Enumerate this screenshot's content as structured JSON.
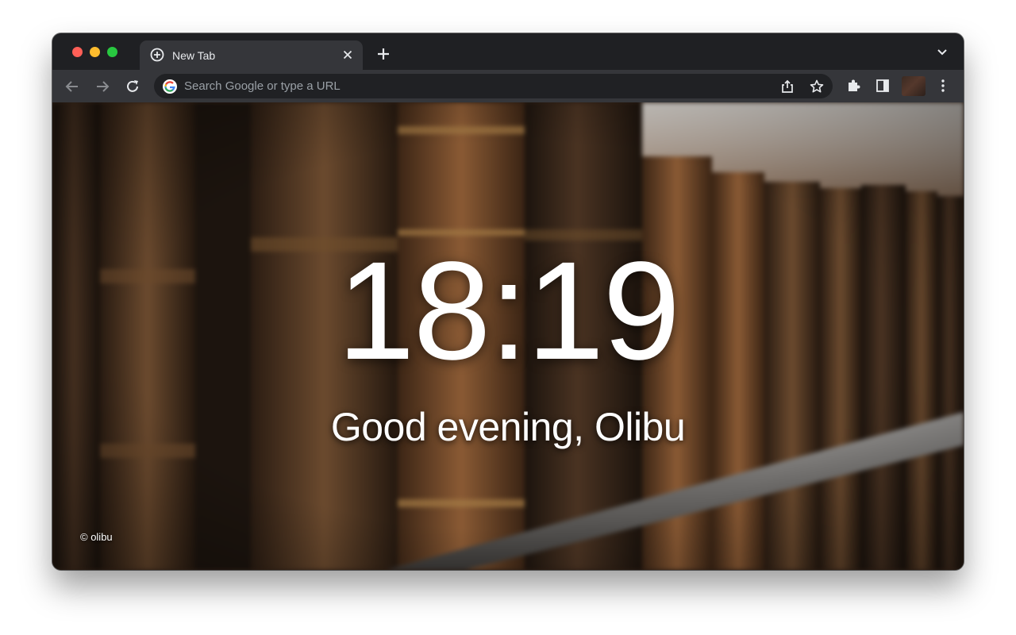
{
  "browser": {
    "tab": {
      "title": "New Tab",
      "close_icon": "close-icon",
      "icon": "add-circle-icon"
    },
    "new_tab_icon": "plus-icon",
    "tab_search_icon": "chevron-down-icon",
    "toolbar": {
      "back_icon": "arrow-left-icon",
      "forward_icon": "arrow-right-icon",
      "reload_icon": "reload-icon",
      "omnibox": {
        "placeholder": "Search Google or type a URL",
        "value": ""
      },
      "share_icon": "share-icon",
      "bookmark_icon": "star-icon",
      "extensions_icon": "puzzle-icon",
      "side_panel_icon": "side-panel-icon",
      "menu_icon": "kebab-menu-icon"
    }
  },
  "page": {
    "clock": "18:19",
    "greeting": "Good evening, Olibu",
    "credit": "© olibu"
  },
  "colors": {
    "tabstrip": "#1f2023",
    "toolbar": "#35363a",
    "omnibox": "#202124",
    "icon": "#e8eaed"
  }
}
